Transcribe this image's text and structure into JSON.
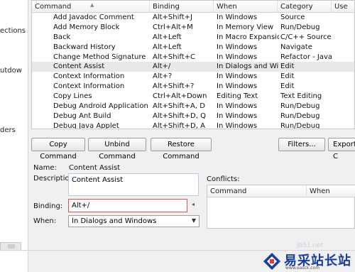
{
  "sidebar_fragments": [
    "ections",
    "utdow",
    "ders"
  ],
  "table": {
    "columns": [
      "Command",
      "Binding",
      "When",
      "Category",
      "Use"
    ],
    "rows": [
      [
        "Add Javadoc Comment",
        "Alt+Shift+J",
        "In Windows",
        "Source"
      ],
      [
        "Add Memory Block",
        "Ctrl+Alt+M",
        "In Memory View",
        "Run/Debug"
      ],
      [
        "Back",
        "Alt+Left",
        "In Macro Expansio...",
        "C/C++ Source"
      ],
      [
        "Backward History",
        "Alt+Left",
        "In Windows",
        "Navigate"
      ],
      [
        "Change Method Signature",
        "Alt+Shift+C",
        "In Windows",
        "Refactor - Java"
      ],
      [
        "Content Assist",
        "Alt+/",
        "In Dialogs and Win...",
        "Edit"
      ],
      [
        "Context Information",
        "Alt+?",
        "In Windows",
        "Edit"
      ],
      [
        "Context Information",
        "Alt+Shift+?",
        "In Windows",
        "Edit"
      ],
      [
        "Copy Lines",
        "Ctrl+Alt+Down",
        "Editing Text",
        "Text Editing"
      ],
      [
        "Debug Android Application",
        "Alt+Shift+A, D",
        "In Windows",
        "Run/Debug"
      ],
      [
        "Debug Ant Build",
        "Alt+Shift+D, Q",
        "In Windows",
        "Run/Debug"
      ],
      [
        "Debug Java Applet",
        "Alt+Shift+D, A",
        "In Windows",
        "Run/Debug"
      ]
    ],
    "selected_index": 5
  },
  "buttons": {
    "copy": "Copy Command",
    "unbind": "Unbind Command",
    "restore": "Restore Command",
    "filters": "Filters...",
    "export": "Export C"
  },
  "details": {
    "name_label": "Name:",
    "name_value": "Content Assist",
    "description_label": "Description:",
    "description_value": "Content Assist",
    "binding_label": "Binding:",
    "binding_value": "Alt+/",
    "when_label": "When:",
    "when_value": "In Dialogs and Windows"
  },
  "conflicts": {
    "label": "Conflicts:",
    "columns": [
      "Command",
      "When"
    ]
  },
  "watermark": {
    "url": "jb51.net",
    "name": "易采站长站",
    "sub": "www.easck.com"
  },
  "colors": {
    "binding_border": "#d9534f",
    "selected_row": "#e8e8e8",
    "watermark_text": "#1a3e9c"
  }
}
